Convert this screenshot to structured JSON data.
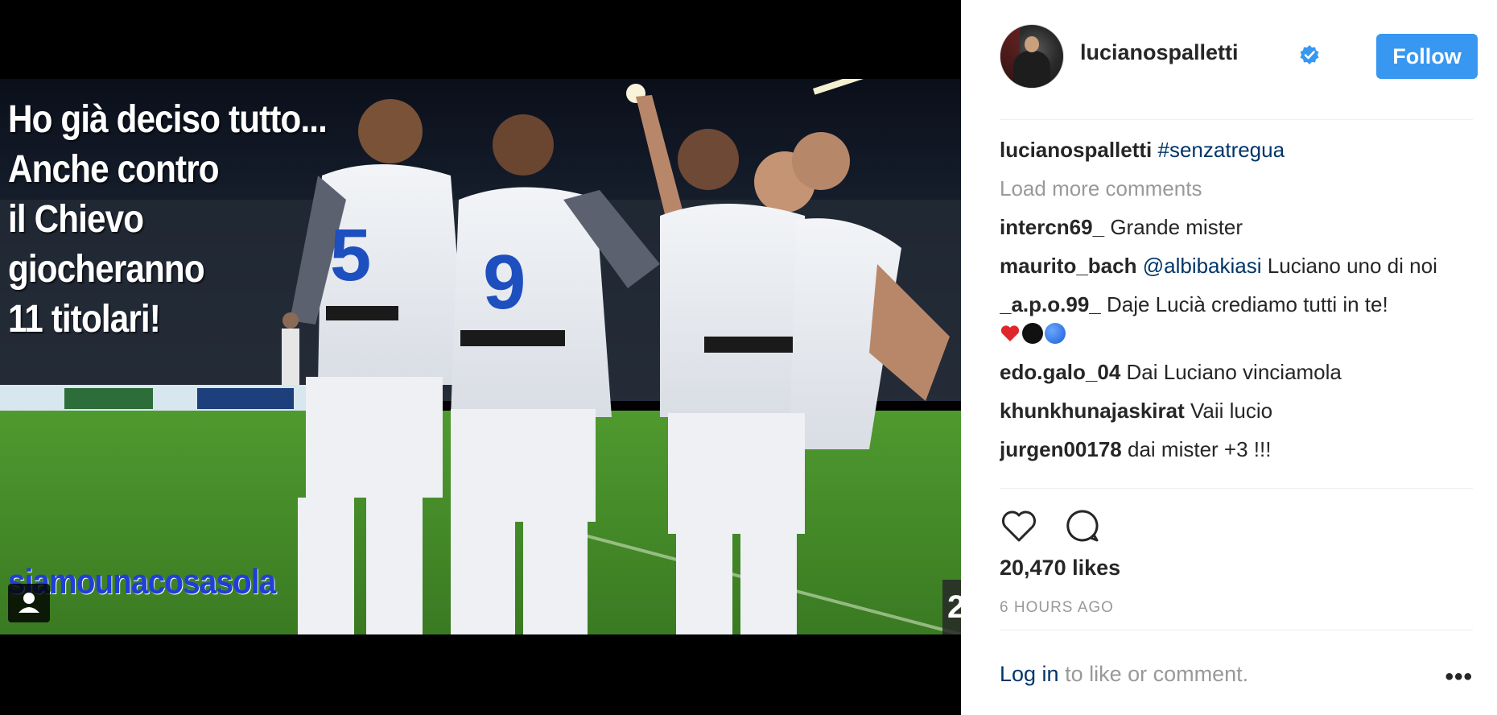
{
  "post": {
    "image_overlay": {
      "lines": [
        "Ho già deciso tutto...",
        "Anche contro",
        "il Chievo",
        "giocheranno",
        "11 titolari!"
      ],
      "hashtag": "siamounacosasola"
    },
    "jersey_numbers": [
      "5",
      "9"
    ],
    "next_label": "2"
  },
  "header": {
    "username": "lucianospalletti",
    "follow_label": "Follow"
  },
  "comments": {
    "caption": {
      "user": "lucianospalletti",
      "text": "#senzatregua"
    },
    "load_more": "Load more comments",
    "items": [
      {
        "user": "intercn69_",
        "text": "Grande mister"
      },
      {
        "user": "maurito_bach",
        "mention": "@albibakiasi",
        "text": "Luciano uno di noi"
      },
      {
        "user": "_a.p.o.99_",
        "text": "Daje Lucià crediamo tutti in te!"
      },
      {
        "user": "edo.galo_04",
        "text": "Dai Luciano vinciamola"
      },
      {
        "user": "khunkhunajaskirat",
        "text": "Vaii lucio"
      },
      {
        "user": "jurgen00178",
        "text": "dai mister +3 !!!"
      }
    ]
  },
  "stats": {
    "likes": "20,470 likes",
    "time": "6 HOURS AGO"
  },
  "footer": {
    "login_link": "Log in",
    "login_text": " to like or comment.",
    "more": "•••"
  },
  "colors": {
    "follow_bg": "#3897f0",
    "link": "#003569",
    "muted": "#999999",
    "verified": "#3897f0"
  }
}
